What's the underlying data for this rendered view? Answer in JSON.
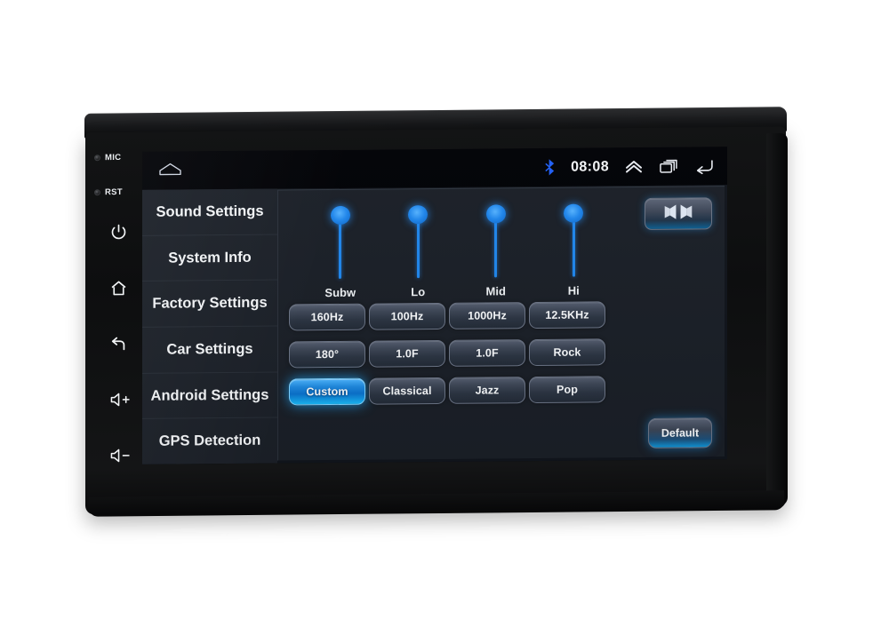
{
  "device": {
    "mic_label": "MIC",
    "rst_label": "RST",
    "hw_buttons": [
      {
        "name": "power",
        "glyph": "power-icon"
      },
      {
        "name": "home",
        "glyph": "home-icon"
      },
      {
        "name": "back",
        "glyph": "back-icon"
      },
      {
        "name": "volume-up",
        "glyph": "volume-up-icon"
      },
      {
        "name": "volume-down",
        "glyph": "volume-down-icon"
      }
    ]
  },
  "statusbar": {
    "home_icon": "home-icon",
    "bluetooth_icon": "bluetooth-icon",
    "time": "08:08",
    "expand_icon": "chevron-up-icon",
    "recents_icon": "recent-apps-icon",
    "back_icon": "back-arrow-icon"
  },
  "sidebar": {
    "items": [
      {
        "label": "Sound Settings"
      },
      {
        "label": "System Info"
      },
      {
        "label": "Factory Settings"
      },
      {
        "label": "Car Settings"
      },
      {
        "label": "Android Settings"
      },
      {
        "label": "GPS Detection"
      }
    ],
    "selected": "Sound Settings"
  },
  "panel": {
    "balance_button": {
      "icon": "balance-fader-icon",
      "label": ""
    },
    "sliders": [
      {
        "label": "Subw",
        "value": 82
      },
      {
        "label": "Lo",
        "value": 82
      },
      {
        "label": "Mid",
        "value": 82
      },
      {
        "label": "Hi",
        "value": 82
      }
    ],
    "grid_buttons": [
      {
        "label": "160Hz",
        "active": false
      },
      {
        "label": "100Hz",
        "active": false
      },
      {
        "label": "1000Hz",
        "active": false
      },
      {
        "label": "12.5KHz",
        "active": false
      },
      {
        "label": "180°",
        "active": false
      },
      {
        "label": "1.0F",
        "active": false
      },
      {
        "label": "1.0F",
        "active": false
      },
      {
        "label": "Rock",
        "active": false
      },
      {
        "label": "Custom",
        "active": true
      },
      {
        "label": "Classical",
        "active": false
      },
      {
        "label": "Jazz",
        "active": false
      },
      {
        "label": "Pop",
        "active": false
      }
    ],
    "default_button": "Default"
  },
  "colors": {
    "accent_blue": "#1f86ec",
    "active_button": "#19b7f5",
    "screen_bg": "#11151c",
    "sidebar_bg": "#1b2028",
    "panel_bg": "#1a1f27"
  }
}
